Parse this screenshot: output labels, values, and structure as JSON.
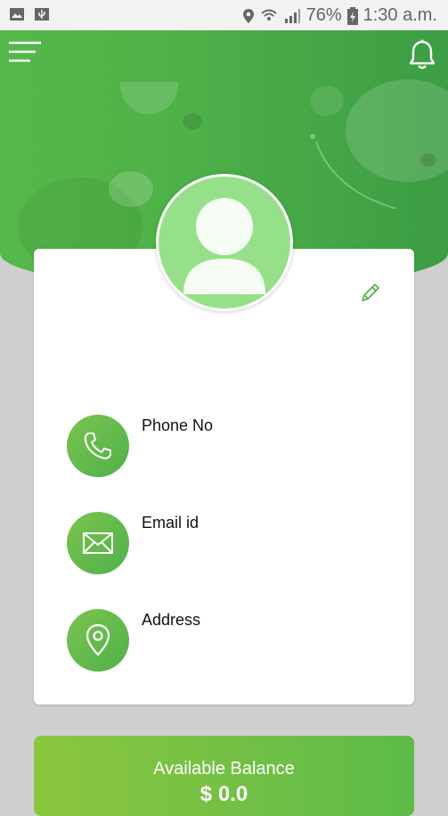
{
  "status_bar": {
    "battery": "76%",
    "time": "1:30 a.m."
  },
  "profile": {
    "phone_label": "Phone No",
    "email_label": "Email id",
    "address_label": "Address"
  },
  "balance": {
    "title": "Available Balance",
    "amount": "$ 0.0"
  },
  "colors": {
    "primary_green": "#4eb148",
    "light_green": "#97e08a",
    "accent": "#8cc63f"
  },
  "icons": [
    "gallery-icon",
    "usb-icon",
    "location-icon",
    "wifi-icon",
    "signal-icon",
    "battery-icon",
    "menu-icon",
    "bell-icon",
    "user-icon",
    "edit-icon",
    "phone-icon",
    "mail-icon",
    "location-pin-icon"
  ]
}
